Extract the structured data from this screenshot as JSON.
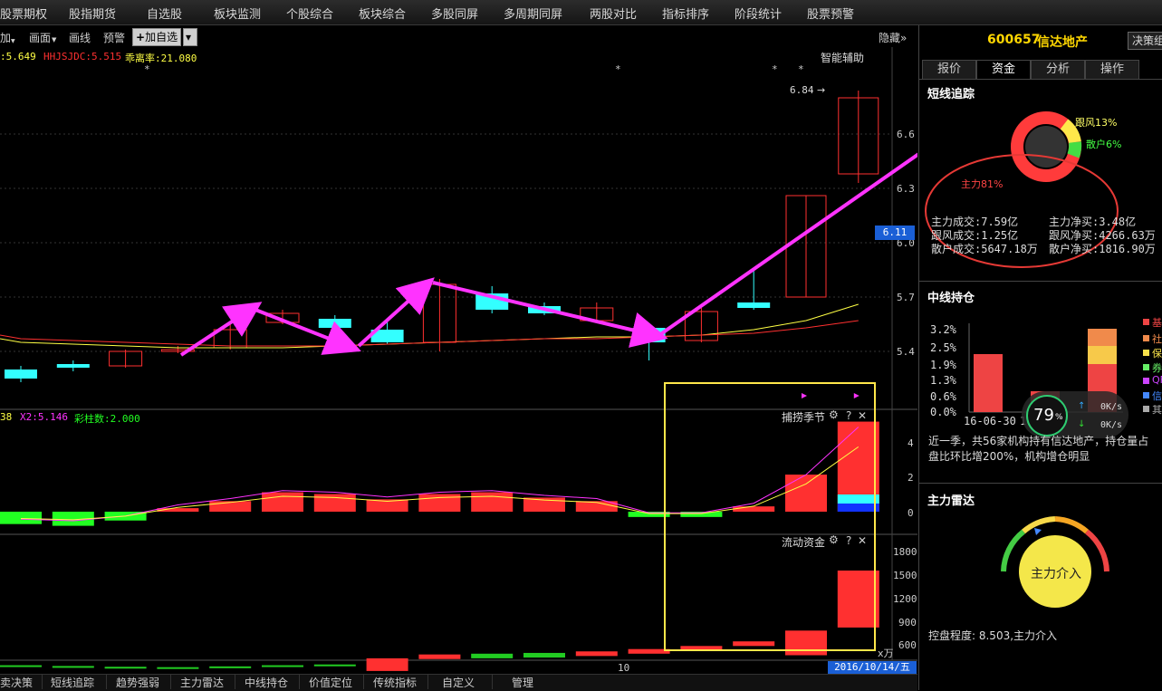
{
  "topnav": [
    "股票期权",
    "股指期货",
    "自选股",
    "板块监测",
    "个股综合",
    "板块综合",
    "多股同屏",
    "多周期同屏",
    "两股对比",
    "指标排序",
    "阶段统计",
    "股票预警"
  ],
  "toolbar": {
    "item0": "加",
    "item1": "画面",
    "item2": "画线",
    "item3": "预警",
    "add_label": "加自选",
    "hide_label": "隐藏"
  },
  "price_legend": {
    "a": ":5.649",
    "b": "HHJSJDC:5.515",
    "c": "乖离率:21.080"
  },
  "smart_assist": "智能辅助",
  "price_axis": [
    "6.6",
    "6.3",
    "6.0",
    "5.7",
    "5.4"
  ],
  "current_price": "6.11",
  "high_label": "6.84",
  "star": "*",
  "osc_legend": {
    "a": "38",
    "b": "X2:5.146",
    "c": "彩柱数:2.000"
  },
  "osc_title": "捕捞季节",
  "osc_axis": [
    "4",
    "2",
    "0"
  ],
  "fund_title": "流动资金",
  "fund_axis": [
    "1800",
    "1500",
    "1200",
    "900",
    "600"
  ],
  "fund_unit": "x万",
  "x_tick": "10",
  "date_label": "2016/10/14/五",
  "panel_icons": {
    "gear": "⚙",
    "help": "?",
    "close": "✕"
  },
  "bottom_tabs": [
    "卖决策",
    "短线追踪",
    "趋势强弱",
    "主力雷达",
    "中线持仓",
    "价值定位",
    "传统指标",
    "自定义",
    "管理"
  ],
  "stock": {
    "code": "600657",
    "name": "信达地产",
    "decision_btn": "决策组"
  },
  "right_tabs": [
    "报价",
    "资金",
    "分析",
    "操作"
  ],
  "short_track": {
    "title": "短线追踪",
    "donut_labels": {
      "follow": "跟风13%",
      "retail": "散户6%",
      "main": "主力81%"
    },
    "rows": [
      [
        "主力成交:7.59亿",
        "主力净买:3.48亿"
      ],
      [
        "跟风成交:1.25亿",
        "跟风净买:4266.63万"
      ],
      [
        "散户成交:5647.18万",
        "散户净买:1816.90万"
      ]
    ]
  },
  "mid_hold": {
    "title": "中线持仓",
    "y_ticks": [
      "3.2%",
      "2.5%",
      "1.9%",
      "1.3%",
      "0.6%",
      "0.0%"
    ],
    "x_ticks": [
      "16-06-30",
      "16"
    ],
    "legend": [
      "基",
      "社",
      "保",
      "券",
      "QF",
      "信",
      "其"
    ],
    "speed_pct": "79",
    "speed_unit": "%",
    "speed_up": "0K/s",
    "speed_down": "0K/s",
    "desc1": "近一季，共56家机构持有信达地产，持仓量占",
    "desc2": "盘比环比增200%，机构增仓明显"
  },
  "radar": {
    "title": "主力雷达",
    "center": "主力介入",
    "footer": "控盘程度: 8.503,主力介入"
  },
  "colors": {
    "up": "#ff3030",
    "down": "#33ffff",
    "green": "#22ff22",
    "magenta": "#ff33ff",
    "yellow": "#ffff44",
    "highlight": "#ffe74a",
    "accent": "#ffd700"
  },
  "chart_data": {
    "type": "candlestick",
    "ylim": [
      5.25,
      6.9
    ],
    "candles": [
      {
        "o": 5.3,
        "c": 5.25,
        "h": 5.32,
        "l": 5.23
      },
      {
        "o": 5.33,
        "c": 5.31,
        "h": 5.35,
        "l": 5.29
      },
      {
        "o": 5.32,
        "c": 5.4,
        "h": 5.41,
        "l": 5.31
      },
      {
        "o": 5.4,
        "c": 5.41,
        "h": 5.43,
        "l": 5.39
      },
      {
        "o": 5.42,
        "c": 5.52,
        "h": 5.56,
        "l": 5.41
      },
      {
        "o": 5.56,
        "c": 5.61,
        "h": 5.63,
        "l": 5.55
      },
      {
        "o": 5.58,
        "c": 5.53,
        "h": 5.6,
        "l": 5.52
      },
      {
        "o": 5.52,
        "c": 5.45,
        "h": 5.57,
        "l": 5.44
      },
      {
        "o": 5.45,
        "c": 5.77,
        "h": 5.8,
        "l": 5.4
      },
      {
        "o": 5.72,
        "c": 5.63,
        "h": 5.76,
        "l": 5.61
      },
      {
        "o": 5.65,
        "c": 5.61,
        "h": 5.67,
        "l": 5.6
      },
      {
        "o": 5.57,
        "c": 5.64,
        "h": 5.67,
        "l": 5.56
      },
      {
        "o": 5.53,
        "c": 5.45,
        "h": 5.54,
        "l": 5.35
      },
      {
        "o": 5.46,
        "c": 5.62,
        "h": 5.64,
        "l": 5.45
      },
      {
        "o": 5.67,
        "c": 5.64,
        "h": 5.86,
        "l": 5.63
      },
      {
        "o": 5.7,
        "c": 6.26,
        "h": 6.26,
        "l": 5.7
      },
      {
        "o": 6.38,
        "c": 6.8,
        "h": 6.84,
        "l": 6.33
      }
    ],
    "ma1": [
      5.45,
      5.44,
      5.43,
      5.42,
      5.42,
      5.42,
      5.43,
      5.44,
      5.45,
      5.46,
      5.47,
      5.48,
      5.48,
      5.49,
      5.52,
      5.57,
      5.66
    ],
    "ma2": [
      5.47,
      5.46,
      5.45,
      5.44,
      5.43,
      5.43,
      5.43,
      5.44,
      5.45,
      5.46,
      5.47,
      5.47,
      5.48,
      5.49,
      5.5,
      5.53,
      5.57
    ],
    "osc": [
      -0.7,
      -0.8,
      -0.5,
      0.2,
      0.6,
      1.1,
      1.0,
      0.7,
      1.0,
      1.1,
      0.8,
      0.6,
      -0.3,
      -0.3,
      0.3,
      2.1,
      5.1
    ],
    "fund": [
      570,
      560,
      550,
      545,
      555,
      570,
      580,
      660,
      710,
      720,
      730,
      750,
      780,
      820,
      880,
      1020,
      1800
    ]
  }
}
